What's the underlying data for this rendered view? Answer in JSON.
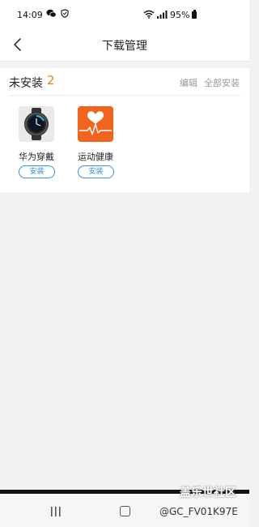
{
  "status_bar": {
    "time": "14:09",
    "battery_pct": "95%",
    "icons": [
      "wechat-icon",
      "shield-icon",
      "wifi-icon",
      "signal-icon",
      "battery-icon"
    ]
  },
  "nav": {
    "title": "下载管理",
    "back_icon": "chevron-left-icon"
  },
  "section": {
    "label": "未安装",
    "count": "2",
    "edit_label": "编辑",
    "install_all_label": "全部安装"
  },
  "apps": [
    {
      "name": "华为穿戴",
      "button": "安装",
      "icon": "smartwatch-icon"
    },
    {
      "name": "运动健康",
      "button": "安装",
      "icon": "heart-pulse-icon"
    }
  ],
  "system_nav": {
    "icons": [
      "recent-apps-icon",
      "home-icon",
      "back-icon"
    ]
  },
  "watermark": {
    "line1": "盖乐世社区",
    "line2": "@GC_FV01K97E"
  },
  "colors": {
    "accent_count": "#e08a1e",
    "install_button": "#3a8ede",
    "health_icon_bg": "#f0641e"
  }
}
